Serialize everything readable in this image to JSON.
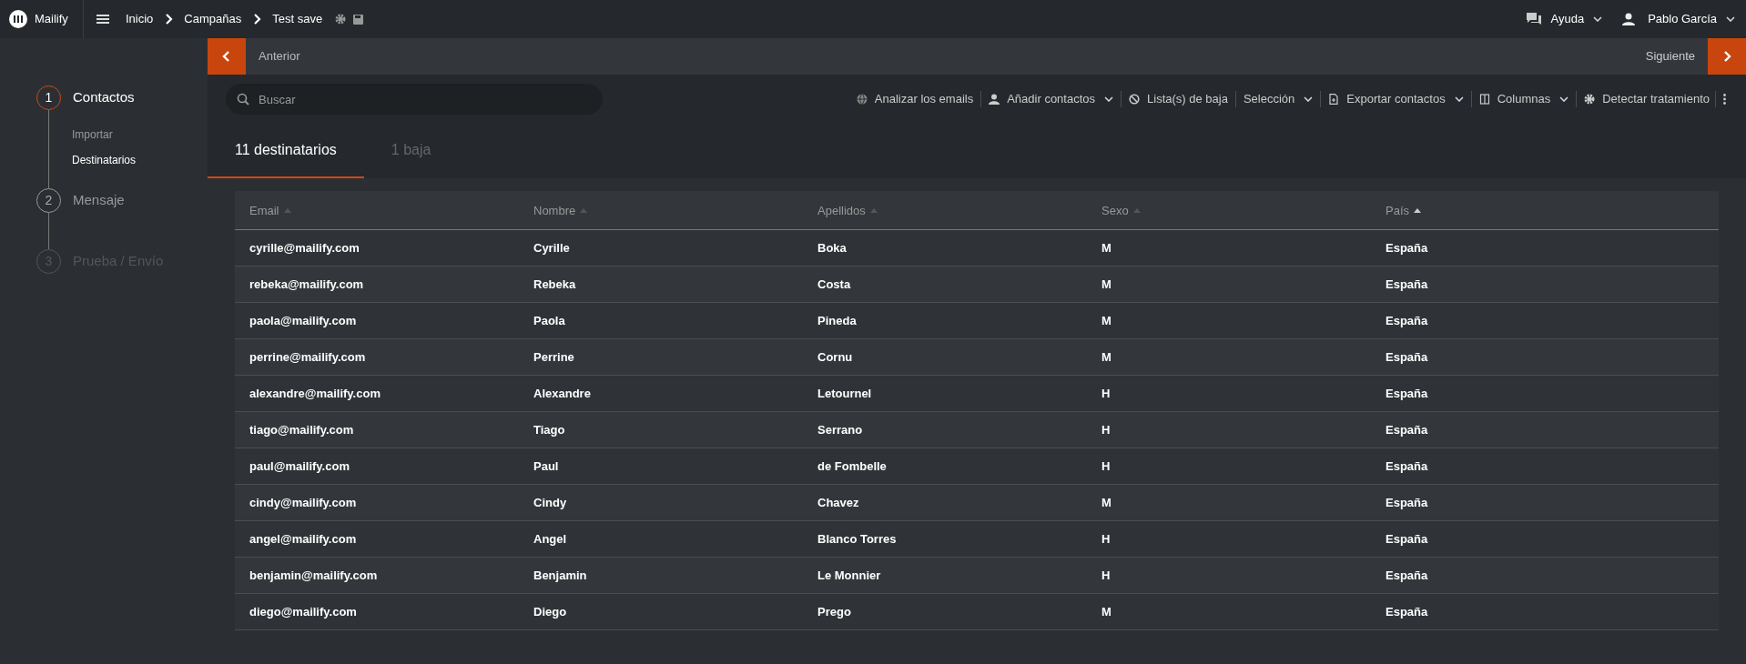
{
  "header": {
    "logo": "Mailify",
    "breadcrumb": [
      "Inicio",
      "Campañas",
      "Test save"
    ],
    "help": "Ayuda",
    "user": "Pablo García"
  },
  "nav": {
    "prev": "Anterior",
    "next": "Siguiente"
  },
  "steps": [
    {
      "number": "1",
      "label": "Contactos",
      "active": true,
      "disabled": false,
      "children": [
        {
          "label": "Importar",
          "selected": false
        },
        {
          "label": "Destinatarios",
          "selected": true
        }
      ]
    },
    {
      "number": "2",
      "label": "Mensaje",
      "active": false,
      "disabled": false
    },
    {
      "number": "3",
      "label": "Prueba / Envío",
      "active": false,
      "disabled": true
    }
  ],
  "search": {
    "placeholder": "Buscar"
  },
  "toolbar": [
    {
      "label": "Analizar los emails",
      "dropdown": false
    },
    {
      "label": "Añadir contactos",
      "dropdown": true
    },
    {
      "label": "Lista(s) de baja",
      "dropdown": false
    },
    {
      "label": "Selección",
      "dropdown": true
    },
    {
      "label": "Exportar contactos",
      "dropdown": true
    },
    {
      "label": "Columnas",
      "dropdown": true
    },
    {
      "label": "Detectar tratamiento",
      "dropdown": false
    }
  ],
  "tabs": [
    {
      "label": "11 destinatarios",
      "selected": true
    },
    {
      "label": "1 baja",
      "selected": false
    }
  ],
  "table": {
    "columns": [
      {
        "label": "Email",
        "sorted": false
      },
      {
        "label": "Nombre",
        "sorted": false
      },
      {
        "label": "Apellidos",
        "sorted": false
      },
      {
        "label": "Sexo",
        "sorted": false
      },
      {
        "label": "País",
        "sorted": true
      }
    ],
    "rows": [
      [
        "cyrille@mailify.com",
        "Cyrille",
        "Boka",
        "M",
        "España"
      ],
      [
        "rebeka@mailify.com",
        "Rebeka",
        "Costa",
        "M",
        "España"
      ],
      [
        "paola@mailify.com",
        "Paola",
        "Pineda",
        "M",
        "España"
      ],
      [
        "perrine@mailify.com",
        "Perrine",
        "Cornu",
        "M",
        "España"
      ],
      [
        "alexandre@mailify.com",
        "Alexandre",
        "Letournel",
        "H",
        "España"
      ],
      [
        "tiago@mailify.com",
        "Tiago",
        "Serrano",
        "H",
        "España"
      ],
      [
        "paul@mailify.com",
        "Paul",
        "de Fombelle",
        "H",
        "España"
      ],
      [
        "cindy@mailify.com",
        "Cindy",
        "Chavez",
        "M",
        "España"
      ],
      [
        "angel@mailify.com",
        "Angel",
        "Blanco Torres",
        "H",
        "España"
      ],
      [
        "benjamin@mailify.com",
        "Benjamin",
        "Le Monnier",
        "H",
        "España"
      ],
      [
        "diego@mailify.com",
        "Diego",
        "Prego",
        "M",
        "España"
      ]
    ]
  }
}
